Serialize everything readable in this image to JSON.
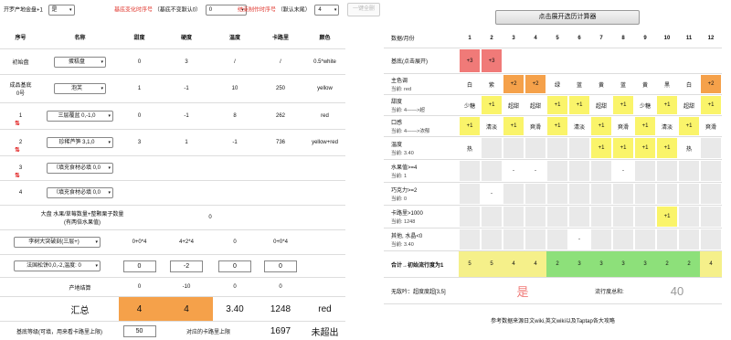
{
  "topbar": {
    "start_label": "开罗产地金盘+1",
    "start_value": "是",
    "change_label": "基底变化时序号",
    "change_hint": "（基底不变默认0）",
    "change_value": "0",
    "end_label": "结束制作时序号",
    "end_hint": "（默认末尾）",
    "end_value": "4",
    "clear_button": "一键全删",
    "calc_button": "点击展开选历计算器"
  },
  "left": {
    "headers": [
      "序号",
      "名称",
      "甜度",
      "硬度",
      "温度",
      "卡路里",
      "颜色"
    ],
    "rows": [
      {
        "idx": "初始盘",
        "name": "蛋糕盘",
        "sweet": "0",
        "hard": "3",
        "temp": "/",
        "cal": "/",
        "color": "0.5*white"
      },
      {
        "idx": "成品基底\n0号",
        "name": "泡芙",
        "sweet": "1",
        "hard": "-1",
        "temp": "10",
        "cal": "250",
        "color": "yellow"
      },
      {
        "idx": "1",
        "name": "三层覆盆  0,-1,0",
        "sweet": "0",
        "hard": "-1",
        "temp": "8",
        "cal": "262",
        "color": "red"
      },
      {
        "idx": "2",
        "name": "珍稀芦笋  3,1,0",
        "sweet": "3",
        "hard": "1",
        "temp": "-1",
        "cal": "736",
        "color": "yellow+red"
      },
      {
        "idx": "3",
        "name": "（填充食材必填  0,0",
        "sweet": "",
        "hard": "",
        "temp": "",
        "cal": "",
        "color": ""
      },
      {
        "idx": "4",
        "name": "（填充食材必填  0,0",
        "sweet": "",
        "hard": "",
        "temp": "",
        "cal": "",
        "color": ""
      }
    ],
    "bigplate_label": "大盘 水果/草莓数量+整颗栗子数量\n(有两倍水果值)",
    "bigplate_value": "0",
    "extra1": {
      "name": "李树大突破刻(三层+)",
      "sweet": "0+0*4",
      "hard": "4+2*4",
      "temp": "0",
      "cal": "0+0*4"
    },
    "extra2": {
      "name": "法国松饼0,0,-2,温度: 0",
      "sweet": "0",
      "hard": "-2",
      "temp": "0",
      "cal": "0"
    },
    "origin": {
      "label": "产地结算",
      "sweet": "0",
      "hard": "-10",
      "temp": "0",
      "cal": "0"
    },
    "total": {
      "label": "汇总",
      "sweet": "4",
      "hard": "4",
      "temp": "3.40",
      "cal": "1248",
      "color": "red"
    },
    "bottom": {
      "label": "基底等级(可填，用来看卡路里上限)",
      "value": "50",
      "mid": "对应的卡路里上限",
      "cal": "1697",
      "status": "未超出"
    }
  },
  "right": {
    "header_label": "数据/月份",
    "months": [
      "1",
      "2",
      "3",
      "4",
      "5",
      "6",
      "7",
      "8",
      "9",
      "10",
      "11",
      "12"
    ],
    "rows": [
      {
        "label": "基底(点击展开)",
        "sub": "",
        "cells": [
          "+3",
          "+3",
          "",
          "",
          "",
          "",
          "",
          "",
          "",
          "",
          "",
          ""
        ],
        "colors": [
          "red",
          "red",
          "",
          "",
          "",
          "",
          "",
          "",
          "",
          "",
          "",
          ""
        ]
      },
      {
        "label": "主色调",
        "sub": "当前: red",
        "cells": [
          "白",
          "紫",
          "+2",
          "+2",
          "绿",
          "蓝",
          "黄",
          "蓝",
          "黄",
          "黑",
          "白",
          "+2"
        ],
        "colors": [
          "",
          "",
          "org",
          "org",
          "",
          "",
          "",
          "",
          "",
          "",
          "",
          "org"
        ]
      },
      {
        "label": "甜度",
        "sub": "当前: 4——>超",
        "cells": [
          "少糖",
          "+1",
          "超甜",
          "超甜",
          "+1",
          "+1",
          "超甜",
          "+1",
          "少糖",
          "+1",
          "超甜",
          "+1"
        ],
        "colors": [
          "",
          "yel",
          "",
          "",
          "yel",
          "yel",
          "",
          "yel",
          "",
          "yel",
          "",
          "yel"
        ]
      },
      {
        "label": "口感",
        "sub": "当前: 4——>浓郁",
        "cells": [
          "+1",
          "清淡",
          "+1",
          "爽滑",
          "+1",
          "清淡",
          "+1",
          "爽滑",
          "+1",
          "清淡",
          "+1",
          "爽滑"
        ],
        "colors": [
          "yel",
          "",
          "yel",
          "",
          "yel",
          "",
          "yel",
          "",
          "yel",
          "",
          "yel",
          ""
        ]
      },
      {
        "label": "温度",
        "sub": "当前: 3.40",
        "cells": [
          "热",
          "",
          "",
          "",
          "",
          "",
          "+1",
          "+1",
          "+1",
          "+1",
          "热",
          ""
        ],
        "colors": [
          "",
          "gry",
          "gry",
          "gry",
          "gry",
          "gry",
          "yel",
          "yel",
          "yel",
          "yel",
          "",
          "gry"
        ]
      },
      {
        "label": "水果值>=4",
        "sub": "当前: 1",
        "cells": [
          "",
          "",
          "-",
          "-",
          "",
          "",
          "",
          "-",
          "",
          "",
          "",
          ""
        ],
        "colors": [
          "gry",
          "gry",
          "",
          "",
          "gry",
          "gry",
          "gry",
          "",
          "gry",
          "gry",
          "gry",
          "gry"
        ]
      },
      {
        "label": "巧克力>=2",
        "sub": "当前: 0",
        "cells": [
          "",
          "-",
          "",
          "",
          "",
          "",
          "",
          "",
          "",
          "",
          "",
          ""
        ],
        "colors": [
          "gry",
          "",
          "gry",
          "gry",
          "gry",
          "gry",
          "gry",
          "gry",
          "gry",
          "gry",
          "gry",
          "gry"
        ]
      },
      {
        "label": "卡路里>1000",
        "sub": "当前: 1248",
        "cells": [
          "",
          "",
          "",
          "",
          "",
          "",
          "",
          "",
          "",
          "+1",
          "",
          ""
        ],
        "colors": [
          "gry",
          "gry",
          "gry",
          "gry",
          "gry",
          "gry",
          "gry",
          "gry",
          "gry",
          "yel",
          "gry",
          "gry"
        ]
      },
      {
        "label": "其他, 水晶<0",
        "sub": "当前: 3.40",
        "cells": [
          "",
          "",
          "",
          "",
          "",
          "-",
          "",
          "",
          "",
          "",
          "",
          ""
        ],
        "colors": [
          "gry",
          "gry",
          "gry",
          "gry",
          "gry",
          "",
          "gry",
          "gry",
          "gry",
          "gry",
          "gry",
          "gry"
        ]
      }
    ],
    "sum_label": "合计→初始流行度为1",
    "sum_cells": [
      "5",
      "5",
      "4",
      "4",
      "2",
      "3",
      "3",
      "3",
      "3",
      "2",
      "2",
      "4"
    ],
    "sum_colors": [
      "y2",
      "y2",
      "y2",
      "y2",
      "grn",
      "grn",
      "grn",
      "grn",
      "grn",
      "grn",
      "grn",
      "y2"
    ],
    "super_label": "无敌吟：超度度超[3,5]",
    "super_value": "是",
    "pop_label": "流行度总和:",
    "pop_value": "40",
    "footer": "参考数据来源日文wiki,英文wiki以及Taptap各大攻略"
  }
}
